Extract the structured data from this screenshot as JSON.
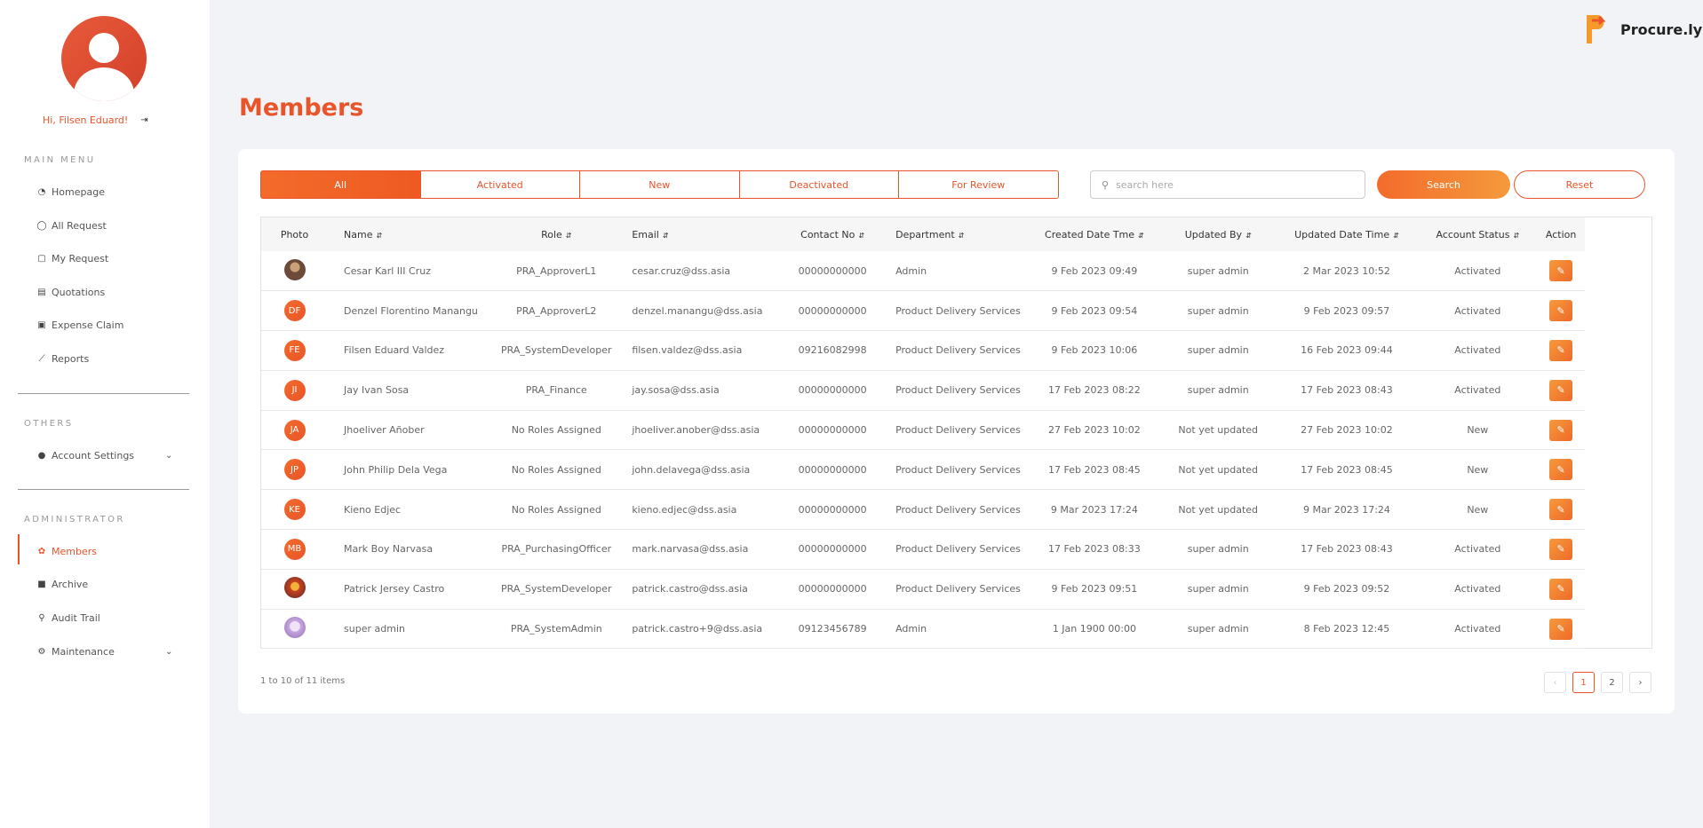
{
  "user": {
    "greeting": "Hi, Filsen Eduard!"
  },
  "sidebar": {
    "main_menu_label": "MAIN MENU",
    "main_menu": [
      {
        "label": "Homepage",
        "icon": "dashboard-icon"
      },
      {
        "label": "All Request",
        "icon": "chat-icon"
      },
      {
        "label": "My Request",
        "icon": "note-icon"
      },
      {
        "label": "Quotations",
        "icon": "list-icon"
      },
      {
        "label": "Expense Claim",
        "icon": "money-icon"
      },
      {
        "label": "Reports",
        "icon": "chart-icon"
      }
    ],
    "others_label": "OTHERS",
    "account_settings": "Account Settings",
    "admin_label": "ADMINISTRATOR",
    "admin_menu": [
      {
        "label": "Members",
        "icon": "users-icon"
      },
      {
        "label": "Archive",
        "icon": "archive-icon"
      },
      {
        "label": "Audit Trail",
        "icon": "search-icon"
      },
      {
        "label": "Maintenance",
        "icon": "cogs-icon"
      }
    ]
  },
  "brand": {
    "name": "Procure.ly"
  },
  "page": {
    "title": "Members"
  },
  "tabs": [
    "All",
    "Activated",
    "New",
    "Deactivated",
    "For Review"
  ],
  "search": {
    "placeholder": "search here",
    "search_label": "Search",
    "reset_label": "Reset"
  },
  "table": {
    "headers": {
      "photo": "Photo",
      "name": "Name",
      "role": "Role",
      "email": "Email",
      "contact": "Contact No",
      "department": "Department",
      "created": "Created Date Tme",
      "updated_by": "Updated By",
      "updated": "Updated Date Time",
      "status": "Account Status",
      "action": "Action"
    },
    "rows": [
      {
        "initials": "",
        "photo": "img1",
        "name": "Cesar Karl III Cruz",
        "role": "PRA_ApproverL1",
        "email": "cesar.cruz@dss.asia",
        "contact": "00000000000",
        "department": "Admin",
        "created": "9 Feb 2023 09:49",
        "updated_by": "super admin",
        "updated": "2 Mar 2023 10:52",
        "status": "Activated"
      },
      {
        "initials": "DF",
        "photo": "",
        "name": "Denzel Florentino Manangu",
        "role": "PRA_ApproverL2",
        "email": "denzel.manangu@dss.asia",
        "contact": "00000000000",
        "department": "Product Delivery Services",
        "created": "9 Feb 2023 09:54",
        "updated_by": "super admin",
        "updated": "9 Feb 2023 09:57",
        "status": "Activated"
      },
      {
        "initials": "FE",
        "photo": "",
        "name": "Filsen Eduard Valdez",
        "role": "PRA_SystemDeveloper",
        "email": "filsen.valdez@dss.asia",
        "contact": "09216082998",
        "department": "Product Delivery Services",
        "created": "9 Feb 2023 10:06",
        "updated_by": "super admin",
        "updated": "16 Feb 2023 09:44",
        "status": "Activated"
      },
      {
        "initials": "JI",
        "photo": "",
        "name": "Jay Ivan Sosa",
        "role": "PRA_Finance",
        "email": "jay.sosa@dss.asia",
        "contact": "00000000000",
        "department": "Product Delivery Services",
        "created": "17 Feb 2023 08:22",
        "updated_by": "super admin",
        "updated": "17 Feb 2023 08:43",
        "status": "Activated"
      },
      {
        "initials": "JA",
        "photo": "",
        "name": "Jhoeliver Añober",
        "role": "No Roles Assigned",
        "email": "jhoeliver.anober@dss.asia",
        "contact": "00000000000",
        "department": "Product Delivery Services",
        "created": "27 Feb 2023 10:02",
        "updated_by": "Not yet updated",
        "updated": "27 Feb 2023 10:02",
        "status": "New"
      },
      {
        "initials": "JP",
        "photo": "",
        "name": "John Philip Dela Vega",
        "role": "No Roles Assigned",
        "email": "john.delavega@dss.asia",
        "contact": "00000000000",
        "department": "Product Delivery Services",
        "created": "17 Feb 2023 08:45",
        "updated_by": "Not yet updated",
        "updated": "17 Feb 2023 08:45",
        "status": "New"
      },
      {
        "initials": "KE",
        "photo": "",
        "name": "Kieno Edjec",
        "role": "No Roles Assigned",
        "email": "kieno.edjec@dss.asia",
        "contact": "00000000000",
        "department": "Product Delivery Services",
        "created": "9 Mar 2023 17:24",
        "updated_by": "Not yet updated",
        "updated": "9 Mar 2023 17:24",
        "status": "New"
      },
      {
        "initials": "MB",
        "photo": "",
        "name": "Mark Boy Narvasa",
        "role": "PRA_PurchasingOfficer",
        "email": "mark.narvasa@dss.asia",
        "contact": "00000000000",
        "department": "Product Delivery Services",
        "created": "17 Feb 2023 08:33",
        "updated_by": "super admin",
        "updated": "17 Feb 2023 08:43",
        "status": "Activated"
      },
      {
        "initials": "",
        "photo": "img2",
        "name": "Patrick Jersey Castro",
        "role": "PRA_SystemDeveloper",
        "email": "patrick.castro@dss.asia",
        "contact": "00000000000",
        "department": "Product Delivery Services",
        "created": "9 Feb 2023 09:51",
        "updated_by": "super admin",
        "updated": "9 Feb 2023 09:52",
        "status": "Activated"
      },
      {
        "initials": "",
        "photo": "img3",
        "name": "super admin",
        "role": "PRA_SystemAdmin",
        "email": "patrick.castro+9@dss.asia",
        "contact": "09123456789",
        "department": "Admin",
        "created": "1 Jan 1900 00:00",
        "updated_by": "super admin",
        "updated": "8 Feb 2023 12:45",
        "status": "Activated"
      }
    ]
  },
  "pagination": {
    "info": "1 to 10 of 11 items",
    "prev": "‹",
    "next": "›",
    "pages": [
      "1",
      "2"
    ],
    "current": "1"
  },
  "colors": {
    "accent": "#e8552a",
    "accent_light": "#f59a3c",
    "background": "#f1f3f6"
  }
}
